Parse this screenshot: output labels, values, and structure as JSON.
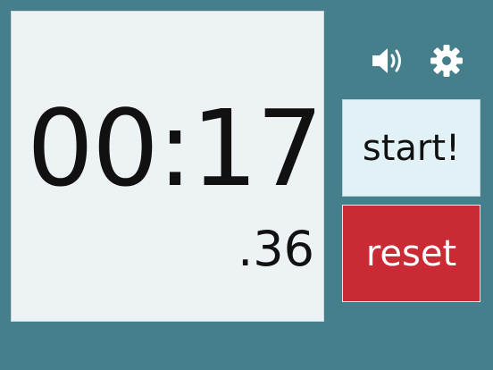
{
  "timer": {
    "main": "00:17",
    "fraction": ".36"
  },
  "controls": {
    "sound_icon": "speaker-volume-icon",
    "settings_icon": "gear-icon",
    "start_label": "start!",
    "reset_label": "reset"
  },
  "colors": {
    "background": "#457f8c",
    "display": "#edf3f5",
    "start_button": "#e2f1f6",
    "reset_button": "#c92a34"
  }
}
